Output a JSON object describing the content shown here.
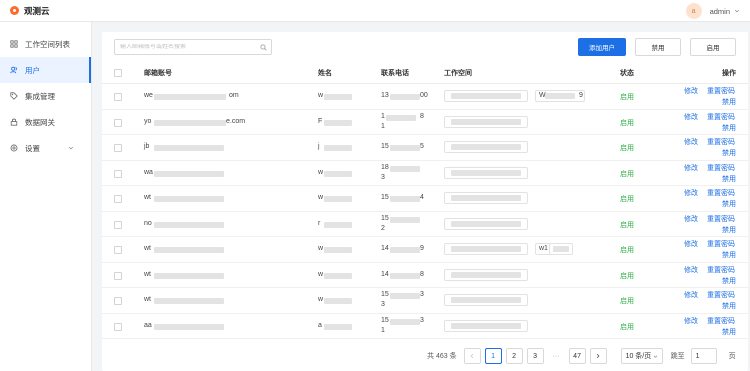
{
  "app": {
    "title": "观测云",
    "user_initial": "a",
    "user_name": "admin"
  },
  "sidebar": {
    "items": [
      {
        "label": "工作空间列表",
        "icon": "grid-icon"
      },
      {
        "label": "用户",
        "icon": "users-icon",
        "active": true
      },
      {
        "label": "集成管理",
        "icon": "tag-icon"
      },
      {
        "label": "数据网关",
        "icon": "lock-icon"
      },
      {
        "label": "设置",
        "icon": "settings-icon"
      }
    ]
  },
  "toolbar": {
    "search_placeholder": "输入邮箱账号或姓名搜索",
    "add_user": "添加用户",
    "disable": "禁用",
    "enable": "启用"
  },
  "table": {
    "columns": {
      "email": "邮箱账号",
      "name": "姓名",
      "phone": "联系电话",
      "workspace": "工作空间",
      "status": "状态",
      "actions": "操作"
    },
    "rows": [
      {
        "email_prefix": "we",
        "email_suffix": "om",
        "name_prefix": "w",
        "phone_prefix": "13",
        "phone_tail": "00",
        "ws_extra_prefix": "W",
        "ws_extra_suffix": "9",
        "status": "启用"
      },
      {
        "email_prefix": "yo",
        "email_suffix": "e.com",
        "name_prefix": "F",
        "phone_prefix": "1",
        "phone_tail": "8",
        "phone_line2": "1",
        "status": "启用"
      },
      {
        "email_prefix": "jb",
        "name_prefix": "j",
        "phone_prefix": "15",
        "phone_tail": "5",
        "status": "启用"
      },
      {
        "email_prefix": "wa",
        "name_prefix": "w",
        "phone_prefix": "18",
        "phone_line2": "3",
        "status": "启用"
      },
      {
        "email_prefix": "wt",
        "name_prefix": "w",
        "phone_prefix": "15",
        "phone_tail": "4",
        "status": "启用"
      },
      {
        "email_prefix": "no",
        "name_prefix": "r",
        "phone_prefix": "15",
        "phone_line2": "2",
        "status": "启用"
      },
      {
        "email_prefix": "wt",
        "name_prefix": "w",
        "phone_prefix": "14",
        "phone_tail": "9",
        "ws_extra_prefix": "w1",
        "status": "启用"
      },
      {
        "email_prefix": "wt",
        "name_prefix": "w",
        "phone_prefix": "14",
        "phone_tail": "8",
        "status": "启用"
      },
      {
        "email_prefix": "wt",
        "name_prefix": "w",
        "phone_prefix": "15",
        "phone_tail": "3",
        "phone_line2": "3",
        "status": "启用"
      },
      {
        "email_prefix": "aa",
        "name_prefix": "a",
        "phone_prefix": "15",
        "phone_tail": "3",
        "phone_line2": "1",
        "status": "启用"
      }
    ],
    "action_labels": {
      "edit": "修改",
      "reset_password": "重置密码",
      "disable": "禁用"
    }
  },
  "pagination": {
    "total": "共 463 条",
    "pages": [
      "1",
      "2",
      "3",
      "47"
    ],
    "current": "1",
    "ellipsis": "···",
    "page_size": "10 条/页",
    "goto_label": "跳至",
    "goto_value": "1",
    "page_unit": "页"
  },
  "colors": {
    "primary": "#1d6fe5",
    "enabled": "#2eae45",
    "logo": "#ff6a2a"
  }
}
